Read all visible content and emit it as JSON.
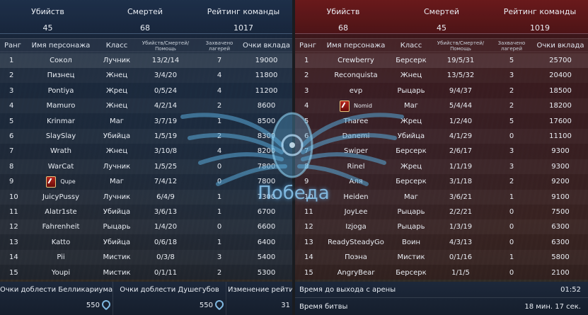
{
  "columns": {
    "rank": "Ранг",
    "name": "Имя персонажа",
    "class": "Класс",
    "kda": "Убийств/Смертей/Помощь",
    "camps": "Захвачено лагерей",
    "points": "Очки вклада"
  },
  "left_team": {
    "summary": {
      "kills_label": "Убийств",
      "kills": "45",
      "deaths_label": "Смертей",
      "deaths": "68",
      "rating_label": "Рейтинг команды",
      "rating": "1017"
    },
    "players": [
      {
        "rank": "1",
        "name": "Сокол",
        "class": "Лучник",
        "kda": "13/2/14",
        "camps": "7",
        "points": "19000"
      },
      {
        "rank": "2",
        "name": "Пизнец",
        "class": "Жнец",
        "kda": "3/4/20",
        "camps": "4",
        "points": "11800"
      },
      {
        "rank": "3",
        "name": "Pontiya",
        "class": "Жрец",
        "kda": "0/5/24",
        "camps": "4",
        "points": "11200"
      },
      {
        "rank": "4",
        "name": "Mamuro",
        "class": "Жнец",
        "kda": "4/2/14",
        "camps": "2",
        "points": "8600"
      },
      {
        "rank": "5",
        "name": "Krinmar",
        "class": "Маг",
        "kda": "3/7/19",
        "camps": "1",
        "points": "8500"
      },
      {
        "rank": "6",
        "name": "SlaySlay",
        "class": "Убийца",
        "kda": "1/5/19",
        "camps": "2",
        "points": "8300"
      },
      {
        "rank": "7",
        "name": "Wrath",
        "class": "Жнец",
        "kda": "3/10/8",
        "camps": "4",
        "points": "8200"
      },
      {
        "rank": "8",
        "name": "WarCat",
        "class": "Лучник",
        "kda": "1/5/25",
        "camps": "0",
        "points": "7800"
      },
      {
        "rank": "9",
        "name": "Qupe",
        "class": "Маг",
        "kda": "7/4/12",
        "camps": "0",
        "points": "7800",
        "badge": true
      },
      {
        "rank": "10",
        "name": "JuicyPussy",
        "class": "Лучник",
        "kda": "6/4/9",
        "camps": "1",
        "points": "7300"
      },
      {
        "rank": "11",
        "name": "Alatr1ste",
        "class": "Убийца",
        "kda": "3/6/13",
        "camps": "1",
        "points": "6700"
      },
      {
        "rank": "12",
        "name": "Fahrenheit",
        "class": "Рыцарь",
        "kda": "1/4/20",
        "camps": "0",
        "points": "6600"
      },
      {
        "rank": "13",
        "name": "Katto",
        "class": "Убийца",
        "kda": "0/6/18",
        "camps": "1",
        "points": "6400"
      },
      {
        "rank": "14",
        "name": "Pii",
        "class": "Мистик",
        "kda": "0/3/8",
        "camps": "3",
        "points": "5400"
      },
      {
        "rank": "15",
        "name": "Youpi",
        "class": "Мистик",
        "kda": "0/1/11",
        "camps": "2",
        "points": "5300"
      }
    ],
    "footer": {
      "col1_label": "Очки доблести Белликариума",
      "col1_value": "550",
      "col2_label": "Очки доблести Душегубов",
      "col2_value": "550",
      "col3_label": "Изменение рейтинга",
      "col3_value": "31"
    }
  },
  "right_team": {
    "summary": {
      "kills_label": "Убийств",
      "kills": "68",
      "deaths_label": "Смертей",
      "deaths": "45",
      "rating_label": "Рейтинг команды",
      "rating": "1019"
    },
    "players": [
      {
        "rank": "1",
        "name": "Crewberry",
        "class": "Берсерк",
        "kda": "19/5/31",
        "camps": "5",
        "points": "25700"
      },
      {
        "rank": "2",
        "name": "Reconquista",
        "class": "Жнец",
        "kda": "13/5/32",
        "camps": "3",
        "points": "20400"
      },
      {
        "rank": "3",
        "name": "evp",
        "class": "Рыцарь",
        "kda": "9/4/37",
        "camps": "2",
        "points": "18500"
      },
      {
        "rank": "4",
        "name": "Nomid",
        "class": "Маг",
        "kda": "5/4/44",
        "camps": "2",
        "points": "18200",
        "badge": true
      },
      {
        "rank": "5",
        "name": "Tharee",
        "class": "Жрец",
        "kda": "1/2/40",
        "camps": "5",
        "points": "17600"
      },
      {
        "rank": "6",
        "name": "Danemi",
        "class": "Убийца",
        "kda": "4/1/29",
        "camps": "0",
        "points": "11100"
      },
      {
        "rank": "7",
        "name": "Swiper",
        "class": "Берсерк",
        "kda": "2/6/17",
        "camps": "3",
        "points": "9300"
      },
      {
        "rank": "8",
        "name": "Rinel",
        "class": "Жрец",
        "kda": "1/1/19",
        "camps": "3",
        "points": "9300"
      },
      {
        "rank": "9",
        "name": "Аля",
        "class": "Берсерк",
        "kda": "3/1/18",
        "camps": "2",
        "points": "9200"
      },
      {
        "rank": "10",
        "name": "Heiden",
        "class": "Маг",
        "kda": "3/6/21",
        "camps": "1",
        "points": "9100"
      },
      {
        "rank": "11",
        "name": "JoyLee",
        "class": "Рыцарь",
        "kda": "2/2/21",
        "camps": "0",
        "points": "7500"
      },
      {
        "rank": "12",
        "name": "Izjoga",
        "class": "Рыцарь",
        "kda": "1/3/19",
        "camps": "0",
        "points": "6300"
      },
      {
        "rank": "13",
        "name": "ReadySteadyGo",
        "class": "Воин",
        "kda": "4/3/13",
        "camps": "0",
        "points": "6300"
      },
      {
        "rank": "14",
        "name": "Поэна",
        "class": "Мистик",
        "kda": "0/1/16",
        "camps": "1",
        "points": "5800"
      },
      {
        "rank": "15",
        "name": "AngryBear",
        "class": "Берсерк",
        "kda": "1/1/5",
        "camps": "0",
        "points": "2100"
      }
    ],
    "footer": {
      "exit_label": "Время до выхода с арены",
      "exit_value": "01:52",
      "battle_label": "Время битвы",
      "battle_value": "18 мин. 17 сек."
    }
  },
  "center": {
    "result_text": "Победа"
  },
  "colors": {
    "left_accent": "#1e304a",
    "right_accent": "#6e1a1c",
    "emblem": "#5aaad8"
  }
}
